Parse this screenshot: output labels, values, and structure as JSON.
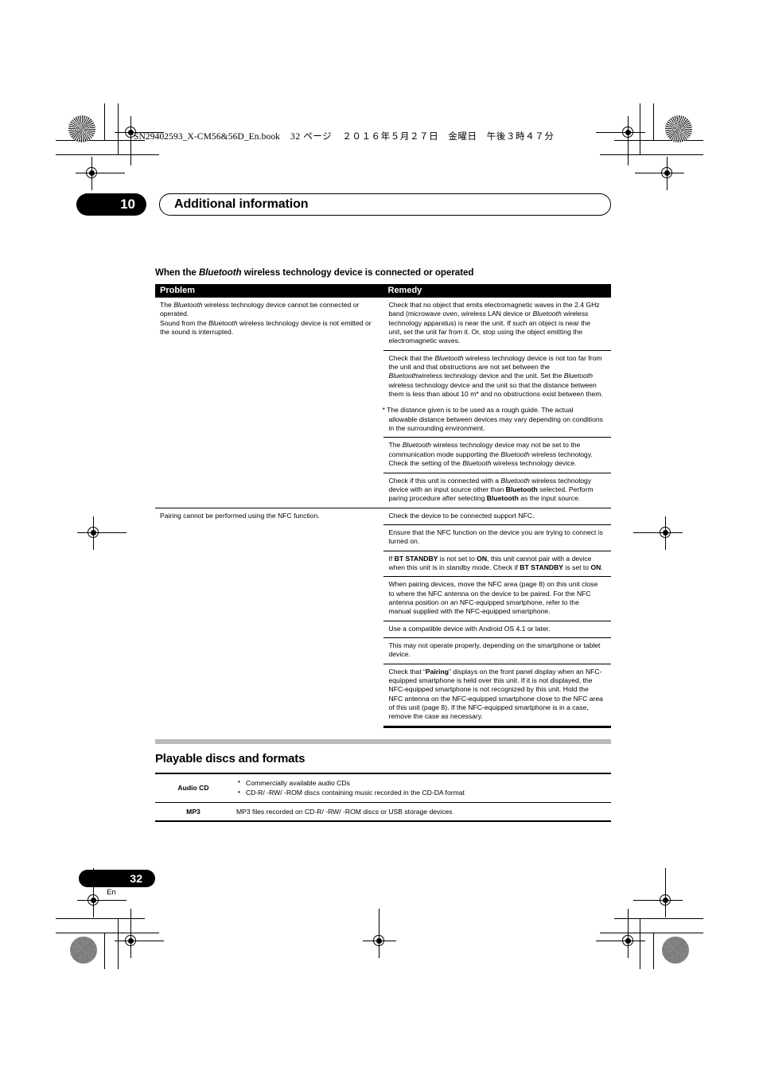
{
  "print_header": {
    "text": "SN29402593_X-CM56&56D_En.book",
    "page_marker": "32 ページ",
    "date": "２０１６年５月２７日　金曜日　午後３時４７分"
  },
  "chapter": {
    "number": "10",
    "title": "Additional information"
  },
  "troubleshooting": {
    "heading_before": "When the ",
    "heading_italic": "Bluetooth",
    "heading_after": " wireless technology device is connected or operated",
    "columns": {
      "problem": "Problem",
      "remedy": "Remedy"
    },
    "rows": [
      {
        "problem_lines": [
          "The |Bluetooth| wireless technology device cannot be connected or operated.",
          "Sound from the |Bluetooth| wireless technology device is not emitted or the sound is interrupted."
        ],
        "remedies": [
          "Check that no object that emits electromagnetic waves in the 2.4 GHz band (microwave oven, wireless LAN device or |Bluetooth| wireless technology apparatus) is near the unit. If such an object is near the unit, set the unit far from it. Or, stop using the object emitting the electromagnetic waves.",
          "Check that the |Bluetooth| wireless technology device is not too far from the unit and that obstructions are not set between the |Bluetooth|wireless technology device and the unit. Set the |Bluetooth| wireless technology device and the unit so that the distance between them is less than about 10 m* and no obstructions exist between them.",
          "The |Bluetooth| wireless technology device may not be set to the communication mode supporting the |Bluetooth| wireless technology. Check the setting of the |Bluetooth| wireless technology device.",
          "Check if this unit is connected with a |Bluetooth| wireless technology device with an input source other than **Bluetooth** selected. Perform paring procedure after selecting **Bluetooth** as the input source."
        ],
        "footnote": "* The distance given is to be used as a rough guide. The actual allowable distance between devices may vary depending on conditions in the surrounding environment.",
        "footnote_after_remedy_index": 2
      },
      {
        "problem_lines": [
          "Pairing cannot be performed using the NFC function."
        ],
        "remedies": [
          "Check the device to be connected support NFC.",
          "Ensure that the NFC function on the device you are trying to connect is turned on.",
          "If **BT STANDBY** is not set to **ON**, this unit cannot pair with a device when this unit is in standby mode. Check if **BT STANDBY** is set to **ON**.",
          "When pairing devices, move the NFC area (page 8) on this unit close to where the NFC antenna on the device to be paired. For the NFC antenna position on an NFC-equipped smartphone, refer to the manual supplied with the NFC-equipped smartphone.",
          "Use a compatible device with Android OS 4.1 or later.",
          "This may not operate properly, depending on the smartphone or tablet device.",
          "Check that “**Pairing**” displays on the front panel display when an NFC-equipped smartphone is held over this unit. If it is not displayed, the NFC-equipped smartphone is not recognized by this unit. Hold the NFC antenna on the NFC-equipped smartphone close to the NFC area of this unit (page 8). If the NFC-equipped smartphone is in a case, remove the case as necessary."
        ]
      }
    ]
  },
  "playable": {
    "heading": "Playable discs and formats",
    "rows": [
      {
        "label": "Audio CD",
        "bullets": [
          "Commercially available audio CDs",
          "CD-R/ -RW/ -ROM discs containing music recorded in the CD-DA format"
        ]
      },
      {
        "label": "MP3",
        "text": "MP3 files recorded on CD-R/ -RW/ -ROM discs or USB storage devices"
      }
    ]
  },
  "footer": {
    "page_number": "32",
    "language": "En"
  },
  "colors": {
    "ink": "#000000",
    "gray_bar": "#b9b9b9"
  }
}
